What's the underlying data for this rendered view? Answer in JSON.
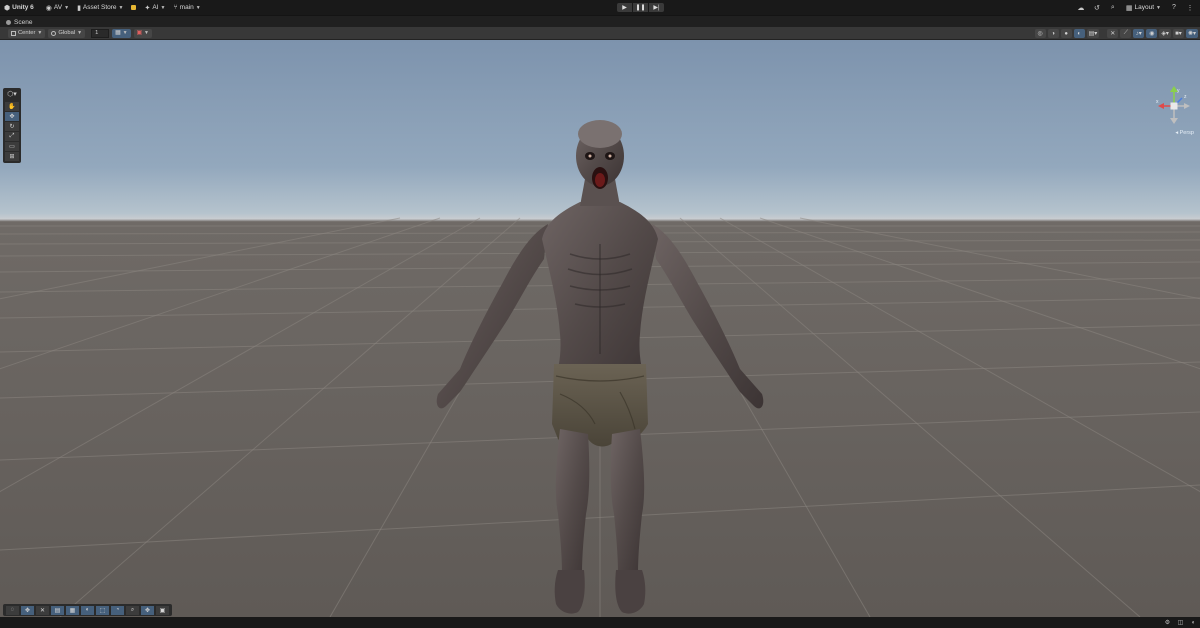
{
  "topbar": {
    "account": "Unity 6",
    "user": "AV",
    "asset_store": "Asset Store",
    "ai": "AI",
    "branch": "main",
    "layout": "Layout"
  },
  "scene_tab": {
    "label": "Scene"
  },
  "toolbar": {
    "pivot_mode": "Center",
    "pivot_rotation": "Global",
    "grid_increment": "1"
  },
  "viewport": {
    "gizmo_label": "Persp",
    "gizmo_axes": [
      "y",
      "x",
      "z"
    ]
  },
  "colors": {
    "accent": "#46607c",
    "sky_top": "#7d93ad",
    "horizon": "#c8ccd0",
    "ground": "#6a6561",
    "gizmo_x": "#e04a4a",
    "gizmo_y": "#8bd14a",
    "gizmo_z": "#4a7ee0"
  },
  "icons": {
    "unity_logo": "unity-logo-icon",
    "user": "user-icon",
    "asset_store": "shopping-bag-icon",
    "ai": "sparkle-icon",
    "branch": "branch-icon",
    "play": "play-icon",
    "pause": "pause-icon",
    "step": "step-icon",
    "cloud": "cloud-icon",
    "history": "history-icon",
    "search": "search-icon",
    "help": "help-icon"
  }
}
